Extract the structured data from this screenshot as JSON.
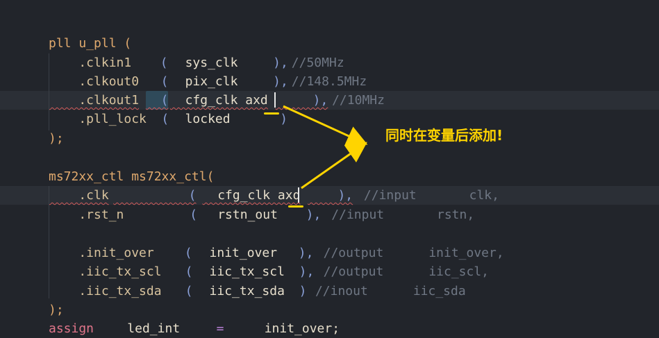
{
  "editor": {
    "lines": [
      {
        "id": "l1",
        "tokens": [
          {
            "t": "pll u_pll (",
            "c": "t-kw"
          }
        ]
      },
      {
        "id": "l2",
        "tokens": [
          {
            "t": "    .clkin1",
            "c": "t-port"
          },
          {
            "t": "   (",
            "c": "t-punc"
          },
          {
            "t": "  sys_clk",
            "c": "t-sig"
          },
          {
            "t": "    ),",
            "c": "t-punc"
          },
          {
            "t": "//50MHz",
            "c": "t-cmt"
          }
        ]
      },
      {
        "id": "l3",
        "tokens": [
          {
            "t": "    .clkout0",
            "c": "t-port"
          },
          {
            "t": "  (",
            "c": "t-punc"
          },
          {
            "t": "  pix_clk",
            "c": "t-sig"
          },
          {
            "t": "    ),",
            "c": "t-punc"
          },
          {
            "t": "//148.5MHz",
            "c": "t-cmt"
          }
        ]
      },
      {
        "id": "l4",
        "tokens": [
          {
            "t": "    .clkout1",
            "c": "t-port"
          },
          {
            "t": "  (",
            "c": "t-punc"
          },
          {
            "t": "  cfg_clk axd",
            "c": "t-sig"
          },
          {
            "t": "     ),",
            "c": "t-punc"
          },
          {
            "t": "//10MHz",
            "c": "t-cmt"
          }
        ]
      },
      {
        "id": "l5",
        "tokens": [
          {
            "t": "    .pll_lock",
            "c": "t-port"
          },
          {
            "t": " (",
            "c": "t-punc"
          },
          {
            "t": "  locked",
            "c": "t-sig"
          },
          {
            "t": "      )",
            "c": "t-punc"
          }
        ]
      },
      {
        "id": "l6",
        "tokens": [
          {
            "t": ");",
            "c": "t-kw"
          }
        ]
      },
      {
        "id": "l7",
        "tokens": []
      },
      {
        "id": "l8",
        "tokens": [
          {
            "t": "ms72xx_ctl ms72xx_ctl(",
            "c": "t-kw"
          }
        ]
      },
      {
        "id": "l9",
        "tokens": [
          {
            "t": "    .clk",
            "c": "t-port"
          },
          {
            "t": "          (",
            "c": "t-punc"
          },
          {
            "t": "  cfg_clk axd",
            "c": "t-sig"
          },
          {
            "t": "    ),",
            "c": "t-punc"
          },
          {
            "t": " //input       clk,",
            "c": "t-cmt"
          }
        ]
      },
      {
        "id": "l10",
        "tokens": [
          {
            "t": "    .rst_n",
            "c": "t-port"
          },
          {
            "t": "        (",
            "c": "t-punc"
          },
          {
            "t": "  rstn_out",
            "c": "t-sig"
          },
          {
            "t": "   ),",
            "c": "t-punc"
          },
          {
            "t": " //input       rstn,",
            "c": "t-cmt"
          }
        ]
      },
      {
        "id": "l11",
        "tokens": []
      },
      {
        "id": "l12",
        "tokens": [
          {
            "t": "    .init_over",
            "c": "t-port"
          },
          {
            "t": "   (",
            "c": "t-punc"
          },
          {
            "t": "  init_over",
            "c": "t-sig"
          },
          {
            "t": "  ),",
            "c": "t-punc"
          },
          {
            "t": " //output      init_over,",
            "c": "t-cmt"
          }
        ]
      },
      {
        "id": "l13",
        "tokens": [
          {
            "t": "    .iic_tx_scl",
            "c": "t-port"
          },
          {
            "t": "  (",
            "c": "t-punc"
          },
          {
            "t": "  iic_tx_scl",
            "c": "t-sig"
          },
          {
            "t": " ),",
            "c": "t-punc"
          },
          {
            "t": " //output      iic_scl,",
            "c": "t-cmt"
          }
        ]
      },
      {
        "id": "l14",
        "tokens": [
          {
            "t": "    .iic_tx_sda",
            "c": "t-port"
          },
          {
            "t": "  (",
            "c": "t-punc"
          },
          {
            "t": "  iic_tx_sda",
            "c": "t-sig"
          },
          {
            "t": " )",
            "c": "t-punc"
          },
          {
            "t": " //inout      iic_sda",
            "c": "t-cmt"
          }
        ]
      },
      {
        "id": "l15",
        "tokens": [
          {
            "t": ");",
            "c": "t-kw"
          }
        ]
      },
      {
        "id": "l16",
        "tokens": [
          {
            "t": "assign",
            "c": "t-assign"
          },
          {
            "t": "    led_int",
            "c": "t-sig"
          },
          {
            "t": "    =",
            "c": "t-op"
          },
          {
            "t": "     init_over;",
            "c": "t-sig"
          }
        ]
      }
    ]
  },
  "annotation": {
    "text": "同时在变量后添加!",
    "color": "#ffd400"
  }
}
